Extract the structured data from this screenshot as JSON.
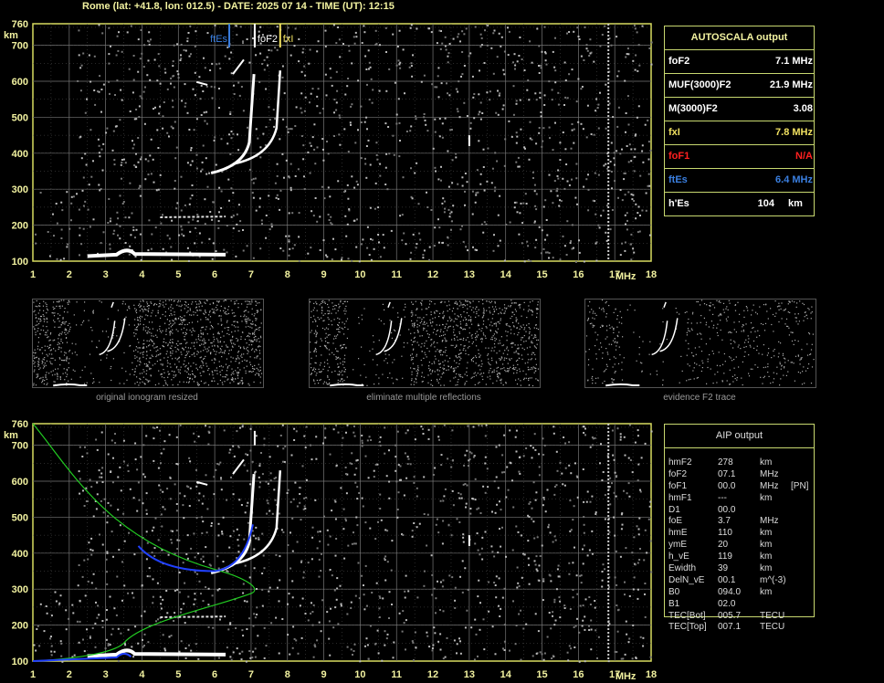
{
  "header": {
    "title": "Rome (lat: +41.8, lon: 012.5) - DATE: 2025 07 14 - TIME (UT): 12:15"
  },
  "ionogram_top": {
    "y_unit": "km",
    "x_unit": "MHz",
    "y_ticks": [
      "760",
      "700",
      "600",
      "500",
      "400",
      "300",
      "200",
      "100"
    ],
    "x_ticks": [
      "1",
      "2",
      "3",
      "4",
      "5",
      "6",
      "7",
      "8",
      "9",
      "10",
      "11",
      "12",
      "13",
      "14",
      "15",
      "16",
      "17",
      "18"
    ],
    "markers": [
      {
        "label": "ftEs",
        "freq": 6.4,
        "color": "#3a7fe0"
      },
      {
        "label": "foF2",
        "freq": 7.1,
        "color": "#ffffff"
      },
      {
        "label": "fxI",
        "freq": 7.8,
        "color": "#f0e060"
      }
    ]
  },
  "autoscala": {
    "title": "AUTOSCALA output",
    "rows": [
      {
        "label": "foF2",
        "value": "7.1 MHz",
        "color": "#ffffff"
      },
      {
        "label": "MUF(3000)F2",
        "value": "21.9 MHz",
        "color": "#ffffff"
      },
      {
        "label": "M(3000)F2",
        "value": "3.08",
        "color": "#ffffff"
      },
      {
        "label": "fxI",
        "value": "7.8 MHz",
        "color": "#f0e060"
      },
      {
        "label": "foF1",
        "value": "N/A",
        "color": "#ff2020"
      },
      {
        "label": "ftEs",
        "value": "6.4 MHz",
        "color": "#3a7fe0"
      },
      {
        "label": "h'Es",
        "value": "104",
        "unit": "km",
        "color": "#ffffff"
      }
    ]
  },
  "thumbnails": [
    {
      "caption": "original ionogram resized"
    },
    {
      "caption": "eliminate multiple reflections"
    },
    {
      "caption": "evidence F2 trace"
    }
  ],
  "ionogram_bottom": {
    "y_unit": "km",
    "x_unit": "MHz",
    "y_ticks": [
      "760",
      "700",
      "600",
      "500",
      "400",
      "300",
      "200",
      "100"
    ],
    "x_ticks": [
      "1",
      "2",
      "3",
      "4",
      "5",
      "6",
      "7",
      "8",
      "9",
      "10",
      "11",
      "12",
      "13",
      "14",
      "15",
      "16",
      "17",
      "18"
    ]
  },
  "aip": {
    "title": "AIP output",
    "rows": [
      {
        "name": "hmF2",
        "value": "278",
        "unit": "km",
        "extra": ""
      },
      {
        "name": "foF2",
        "value": "07.1",
        "unit": "MHz",
        "extra": ""
      },
      {
        "name": "foF1",
        "value": "00.0",
        "unit": "MHz",
        "extra": "[PN]"
      },
      {
        "name": "hmF1",
        "value": "---",
        "unit": "km",
        "extra": ""
      },
      {
        "name": "D1",
        "value": "00.0",
        "unit": "",
        "extra": ""
      },
      {
        "name": "foE",
        "value": "3.7",
        "unit": "MHz",
        "extra": ""
      },
      {
        "name": "hmE",
        "value": "110",
        "unit": "km",
        "extra": ""
      },
      {
        "name": "ymE",
        "value": "20",
        "unit": "km",
        "extra": ""
      },
      {
        "name": "h_vE",
        "value": "119",
        "unit": "km",
        "extra": ""
      },
      {
        "name": "Ewidth",
        "value": "39",
        "unit": "km",
        "extra": ""
      },
      {
        "name": "DelN_vE",
        "value": "00.1",
        "unit": "m^(-3)",
        "extra": ""
      },
      {
        "name": "B0",
        "value": "094.0",
        "unit": "km",
        "extra": ""
      },
      {
        "name": "B1",
        "value": "02.0",
        "unit": "",
        "extra": ""
      },
      {
        "name": "TEC[Bot]",
        "value": "005.7",
        "unit": "TECU",
        "extra": ""
      },
      {
        "name": "TEC[Top]",
        "value": "007.1",
        "unit": "TECU",
        "extra": ""
      }
    ]
  }
}
